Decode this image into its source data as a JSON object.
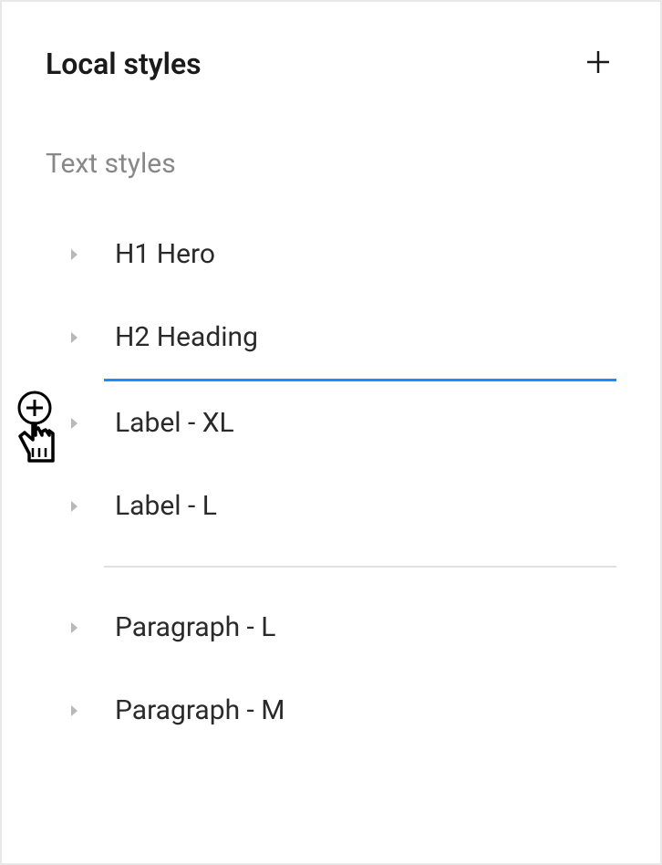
{
  "panel": {
    "title": "Local styles"
  },
  "section": {
    "title": "Text styles"
  },
  "styles": [
    {
      "label": "H1 Hero"
    },
    {
      "label": "H2 Heading"
    },
    {
      "label": "Label - XL"
    },
    {
      "label": "Label - L"
    },
    {
      "label": "Paragraph - L"
    },
    {
      "label": "Paragraph - M"
    }
  ],
  "colors": {
    "dropIndicator": "#1a8cff",
    "divider": "#e0e0e0"
  }
}
